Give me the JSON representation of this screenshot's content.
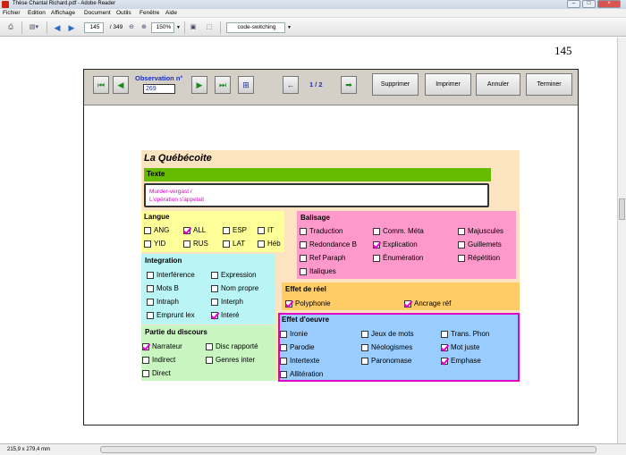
{
  "window": {
    "title": "Thèse Chantal Richard.pdf - Adobe Reader",
    "min": "–",
    "max": "□",
    "close": "×"
  },
  "menus": [
    "Fichier",
    "Edition",
    "Affichage",
    "Document",
    "Outils",
    "Fenêtre",
    "Aide"
  ],
  "toolbar": {
    "page_current": "145",
    "page_total": "/ 349",
    "zoom": "150%",
    "search_value": "code-switching"
  },
  "page_number": "145",
  "form": {
    "observation_label": "Observation n°",
    "observation_value": "269",
    "page_counter": "1 / 2",
    "buttons": {
      "supprimer": "Supprimer",
      "imprimer": "Imprimer",
      "annuler": "Annuler",
      "terminer": "Terminer"
    },
    "record_title": "La Québécoite",
    "texte": {
      "label": "Texte",
      "lines": [
        "Murder-vergast /",
        "L'opération s'appelait"
      ]
    },
    "langue": {
      "label": "Langue",
      "items": [
        {
          "label": "ANG",
          "checked": false
        },
        {
          "label": "ALL",
          "checked": true
        },
        {
          "label": "ESP",
          "checked": false
        },
        {
          "label": "IT",
          "checked": false
        },
        {
          "label": "YID",
          "checked": false
        },
        {
          "label": "RUS",
          "checked": false
        },
        {
          "label": "LAT",
          "checked": false
        },
        {
          "label": "Héb",
          "checked": false
        }
      ]
    },
    "integration": {
      "label": "Integration",
      "items": [
        {
          "label": "Interférence",
          "checked": false
        },
        {
          "label": "Expression",
          "checked": false
        },
        {
          "label": "Mots B",
          "checked": false
        },
        {
          "label": "Nom propre",
          "checked": false
        },
        {
          "label": "Intraph",
          "checked": false
        },
        {
          "label": "Interph",
          "checked": false
        },
        {
          "label": "Emprunt lex",
          "checked": false
        },
        {
          "label": "Interé",
          "checked": true
        }
      ]
    },
    "partie": {
      "label": "Partie du discours",
      "items": [
        {
          "label": "Narrateur",
          "checked": true
        },
        {
          "label": "Disc rapporté",
          "checked": false
        },
        {
          "label": "Indirect",
          "checked": false
        },
        {
          "label": "Genres inter",
          "checked": false
        },
        {
          "label": "Direct",
          "checked": false
        }
      ]
    },
    "balisage": {
      "label": "Balisage",
      "items": [
        {
          "label": "Traduction",
          "checked": false
        },
        {
          "label": "Comm. Méta",
          "checked": false
        },
        {
          "label": "Majuscules",
          "checked": false
        },
        {
          "label": "Redondance B",
          "checked": false
        },
        {
          "label": "Explication",
          "checked": true
        },
        {
          "label": "Guillemets",
          "checked": false
        },
        {
          "label": "Ref Paraph",
          "checked": false
        },
        {
          "label": "Énumération",
          "checked": false
        },
        {
          "label": "Répétition",
          "checked": false
        },
        {
          "label": "Italiques",
          "checked": false
        }
      ]
    },
    "reel": {
      "label": "Effet de réel",
      "items": [
        {
          "label": "Polyphonie",
          "checked": true
        },
        {
          "label": "Ancrage réf",
          "checked": true
        }
      ]
    },
    "oeuvre": {
      "label": "Effet d'oeuvre",
      "items": [
        {
          "label": "Ironie",
          "checked": false
        },
        {
          "label": "Jeux de mots",
          "checked": false
        },
        {
          "label": "Trans. Phon",
          "checked": false
        },
        {
          "label": "Parodie",
          "checked": false
        },
        {
          "label": "Néologismes",
          "checked": false
        },
        {
          "label": "Mot juste",
          "checked": true
        },
        {
          "label": "Intertexte",
          "checked": false
        },
        {
          "label": "Paronomase",
          "checked": false
        },
        {
          "label": "Emphase",
          "checked": true
        },
        {
          "label": "Allitération",
          "checked": false
        }
      ]
    }
  },
  "status": {
    "page_size": "215,9 x 279,4 mm"
  },
  "colors": {
    "record_bg": "#fde4c0",
    "texte_bar": "#66bb00",
    "langue_bg": "#ffff99",
    "integration_bg": "#b9f5f5",
    "partie_bg": "#c8f5c0",
    "balisage_bg": "#ff99cc",
    "reel_bg": "#ffcc66",
    "oeuvre_bg": "#99ccff",
    "check": "#e000c8",
    "blue_text": "#1a2fc8"
  }
}
